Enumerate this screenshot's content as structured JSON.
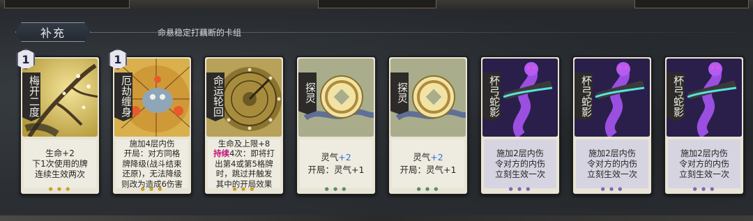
{
  "section": {
    "title": "补充",
    "subtitle": "命悬稳定打藕断的卡组"
  },
  "cards": [
    {
      "name": "梅开二度",
      "cost": "1",
      "desc": [
        "生命+2",
        "下1次使用的牌",
        "连续生效两次"
      ]
    },
    {
      "name": "厄劫缠身",
      "cost": "1",
      "desc": [
        "施加4层内伤",
        "开局：对方同格",
        "牌降级(战斗结束",
        "还原)，无法降级",
        "则改为造成6伤害"
      ]
    },
    {
      "name": "命运轮回",
      "desc_kw": "持续",
      "desc": [
        "生命及上限+8",
        "4次：即将打",
        "出第4或第5格牌",
        "时，跳过并触发",
        "其中的开局效果"
      ]
    },
    {
      "name": "探灵",
      "desc_a": "灵气",
      "desc_a_val": "+2",
      "desc_b": "开局：灵气+1"
    },
    {
      "name": "探灵",
      "desc_a": "灵气",
      "desc_a_val": "+2",
      "desc_b": "开局：灵气+1"
    },
    {
      "name": "杯弓蛇影",
      "desc": [
        "施加2层内伤",
        "令对方的内伤",
        "立刻生效一次"
      ]
    },
    {
      "name": "杯弓蛇影",
      "desc": [
        "施加2层内伤",
        "令对方的内伤",
        "立刻生效一次"
      ]
    },
    {
      "name": "杯弓蛇影",
      "desc": [
        "施加2层内伤",
        "令对方的内伤",
        "立刻生效一次"
      ]
    }
  ],
  "colors": {
    "accent_blue": "#2f6fd2",
    "accent_pink": "#c2187a"
  }
}
